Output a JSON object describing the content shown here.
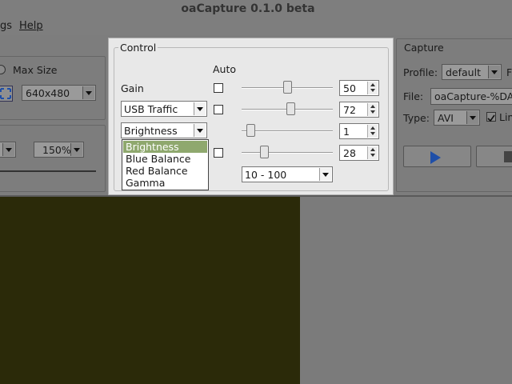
{
  "window": {
    "title": "oaCapture 0.1.0 beta"
  },
  "menubar": {
    "items": [
      "gs",
      "Help"
    ]
  },
  "left_panel": {
    "max_size_label": "Max Size",
    "resolution": "640x480",
    "zoom": "150%"
  },
  "control": {
    "title": "Control",
    "auto_header": "Auto",
    "rows": [
      {
        "label": "Gain",
        "value": "50",
        "slider_fraction": 0.5
      },
      {
        "label": "USB Traffic",
        "value": "72",
        "slider_fraction": 0.54
      },
      {
        "label": "Brightness",
        "value": "1",
        "slider_fraction": 0.06
      },
      {
        "label": "",
        "value": "28",
        "slider_fraction": 0.22
      }
    ],
    "range_select": "10 - 100",
    "popup": {
      "items": [
        "Brightness",
        "Blue Balance",
        "Red Balance",
        "Gamma"
      ],
      "selected": "Brightness"
    }
  },
  "capture": {
    "title": "Capture",
    "profile_label": "Profile:",
    "profile_value": "default",
    "profile_trailing": "F",
    "file_label": "File:",
    "file_value": "oaCapture-%DAT",
    "type_label": "Type:",
    "type_value": "AVI",
    "limit_label": "Lin"
  },
  "colors": {
    "preview": "#2b2a09",
    "popup_selection": "#8fa86e",
    "play_icon": "#1f4fa8"
  }
}
